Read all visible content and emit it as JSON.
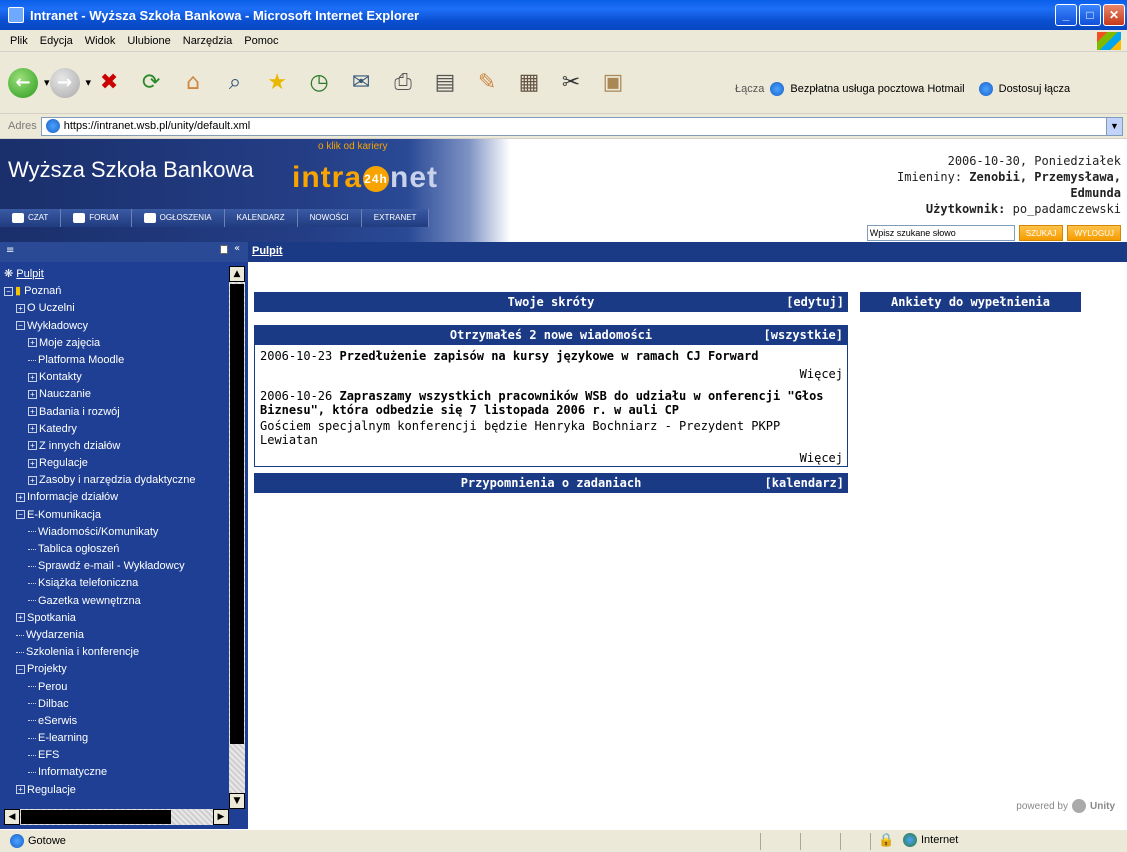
{
  "window": {
    "title": "Intranet - Wyższa Szkoła Bankowa - Microsoft Internet Explorer"
  },
  "menu": [
    "Plik",
    "Edycja",
    "Widok",
    "Ulubione",
    "Narzędzia",
    "Pomoc"
  ],
  "links_bar": {
    "label": "Łącza",
    "items": [
      "Bezpłatna usługa pocztowa Hotmail",
      "Dostosuj łącza"
    ]
  },
  "address": {
    "label": "Adres",
    "url": "https://intranet.wsb.pl/unity/default.xml"
  },
  "header": {
    "school": "Wyższa Szkoła Bankowa",
    "slogan": "o klik od kariery",
    "logo_left": "intra",
    "logo_badge": "24h",
    "logo_right": "net",
    "nav": [
      "CZAT",
      "FORUM",
      "OGŁOSZENIA",
      "KALENDARZ",
      "NOWOŚCI",
      "EXTRANET"
    ],
    "date_line": "2006-10-30, Poniedziałek",
    "nameday_label": "Imieniny:",
    "nameday_value": "Zenobii, Przemysława,",
    "nameday_value2": "Edmunda",
    "user_label": "Użytkownik:",
    "user_value": "po_padamczewski",
    "search_placeholder": "Wpisz szukane słowo",
    "search_button": "SZUKAJ",
    "logout_button": "WYLOGUJ"
  },
  "breadcrumb": "Pulpit",
  "sidebar": {
    "items": [
      {
        "label": "Pulpit",
        "level": 0,
        "mark": "root"
      },
      {
        "label": "Poznań",
        "level": 0,
        "mark": "minus"
      },
      {
        "label": "O Uczelni",
        "level": 1,
        "mark": "plus"
      },
      {
        "label": "Wykładowcy",
        "level": 1,
        "mark": "minus"
      },
      {
        "label": "Moje zajęcia",
        "level": 2,
        "mark": "plus"
      },
      {
        "label": "Platforma Moodle",
        "level": 2,
        "mark": "line"
      },
      {
        "label": "Kontakty",
        "level": 2,
        "mark": "plus"
      },
      {
        "label": "Nauczanie",
        "level": 2,
        "mark": "plus"
      },
      {
        "label": "Badania i rozwój",
        "level": 2,
        "mark": "plus"
      },
      {
        "label": "Katedry",
        "level": 2,
        "mark": "plus"
      },
      {
        "label": "Z innych działów",
        "level": 2,
        "mark": "plus"
      },
      {
        "label": "Regulacje",
        "level": 2,
        "mark": "plus"
      },
      {
        "label": "Zasoby i narzędzia dydaktyczne",
        "level": 2,
        "mark": "plus"
      },
      {
        "label": "Informacje działów",
        "level": 1,
        "mark": "plus"
      },
      {
        "label": "E-Komunikacja",
        "level": 1,
        "mark": "minus"
      },
      {
        "label": "Wiadomości/Komunikaty",
        "level": 2,
        "mark": "line"
      },
      {
        "label": "Tablica ogłoszeń",
        "level": 2,
        "mark": "line"
      },
      {
        "label": "Sprawdź e-mail - Wykładowcy",
        "level": 2,
        "mark": "line"
      },
      {
        "label": "Książka telefoniczna",
        "level": 2,
        "mark": "line"
      },
      {
        "label": "Gazetka wewnętrzna",
        "level": 2,
        "mark": "line"
      },
      {
        "label": "Spotkania",
        "level": 1,
        "mark": "plus"
      },
      {
        "label": "Wydarzenia",
        "level": 1,
        "mark": "line"
      },
      {
        "label": "Szkolenia i konferencje",
        "level": 1,
        "mark": "line"
      },
      {
        "label": "Projekty",
        "level": 1,
        "mark": "minus"
      },
      {
        "label": "Perou",
        "level": 2,
        "mark": "line"
      },
      {
        "label": "Dilbac",
        "level": 2,
        "mark": "line"
      },
      {
        "label": "eSerwis",
        "level": 2,
        "mark": "line"
      },
      {
        "label": "E-learning",
        "level": 2,
        "mark": "line"
      },
      {
        "label": "EFS",
        "level": 2,
        "mark": "line"
      },
      {
        "label": "Informatyczne",
        "level": 2,
        "mark": "line"
      },
      {
        "label": "Regulacje",
        "level": 1,
        "mark": "plus"
      }
    ]
  },
  "panels": {
    "shortcuts": {
      "title": "Twoje skróty",
      "action": "[edytuj]"
    },
    "surveys": {
      "title": "Ankiety do wypełnienia"
    },
    "messages": {
      "title": "Otrzymałeś 2 nowe wiadomości",
      "action": "[wszystkie]",
      "items": [
        {
          "date": "2006-10-23",
          "title": "Przedłużenie zapisów na kursy językowe w ramach CJ Forward",
          "body": "",
          "more": "Więcej"
        },
        {
          "date": "2006-10-26",
          "title": "Zapraszamy wszystkich pracowników WSB do udziału w onferencji \"Głos Biznesu\", która odbedzie się 7 listopada 2006 r. w auli CP",
          "body": "Gościem specjalnym konferencji będzie Henryka Bochniarz - Prezydent PKPP Lewiatan",
          "more": "Więcej"
        }
      ]
    },
    "reminders": {
      "title": "Przypomnienia o zadaniach",
      "action": "[kalendarz]"
    }
  },
  "powered_by": {
    "label": "powered by",
    "brand": "Unity"
  },
  "status": {
    "text": "Gotowe",
    "zone": "Internet"
  }
}
